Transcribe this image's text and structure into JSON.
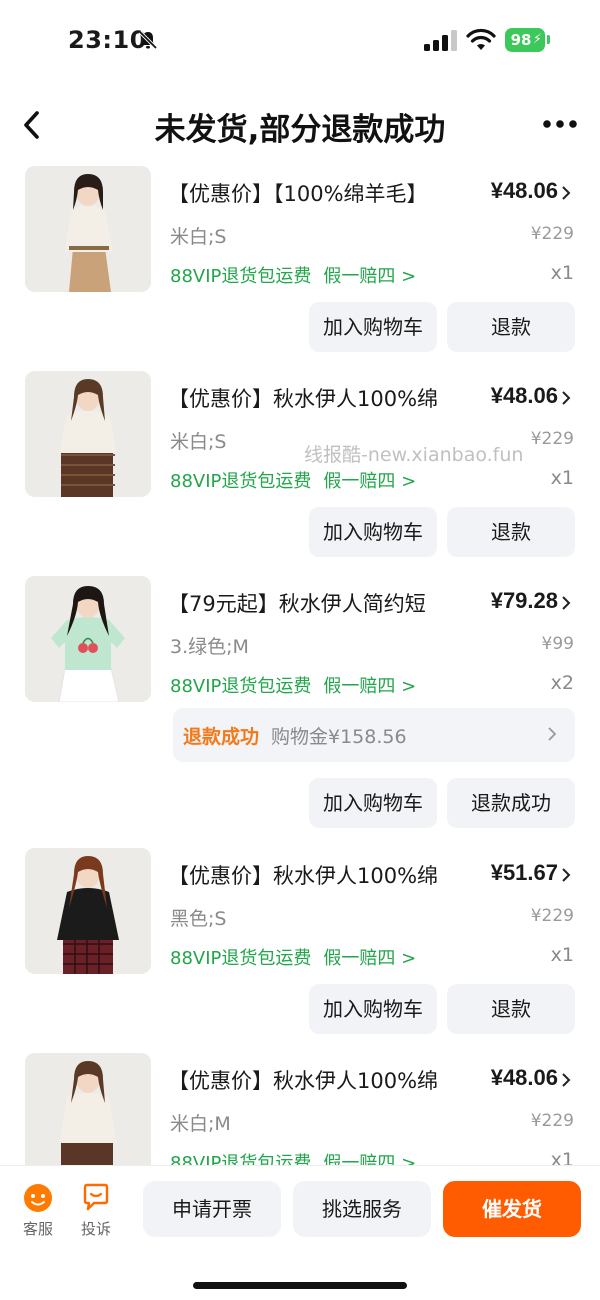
{
  "status_bar": {
    "time": "23:10",
    "battery": "98"
  },
  "header": {
    "title": "未发货,部分退款成功"
  },
  "watermark": "线报酷-new.xianbao.fun",
  "items": [
    {
      "title": "【优惠价】【100%绵羊毛】",
      "price": "¥48.06",
      "spec": "米白;S",
      "orig_price": "¥229",
      "vip": "88VIP退货包运费",
      "guarantee": "假一赔四 >",
      "qty": "x1",
      "cart_label": "加入购物车",
      "refund_label": "退款"
    },
    {
      "title": "【优惠价】秋水伊人100%绵",
      "price": "¥48.06",
      "spec": "米白;S",
      "orig_price": "¥229",
      "vip": "88VIP退货包运费",
      "guarantee": "假一赔四 >",
      "qty": "x1",
      "cart_label": "加入购物车",
      "refund_label": "退款"
    },
    {
      "title": "【79元起】秋水伊人简约短",
      "price": "¥79.28",
      "spec": "3.绿色;M",
      "orig_price": "¥99",
      "vip": "88VIP退货包运费",
      "guarantee": "假一赔四 >",
      "qty": "x2",
      "refund_status_label": "退款成功",
      "refund_status_amount": "购物金¥158.56",
      "cart_label": "加入购物车",
      "refund_label": "退款成功"
    },
    {
      "title": "【优惠价】秋水伊人100%绵",
      "price": "¥51.67",
      "spec": "黑色;S",
      "orig_price": "¥229",
      "vip": "88VIP退货包运费",
      "guarantee": "假一赔四 >",
      "qty": "x1",
      "cart_label": "加入购物车",
      "refund_label": "退款"
    },
    {
      "title": "【优惠价】秋水伊人100%绵",
      "price": "¥48.06",
      "spec": "米白;M",
      "orig_price": "¥229",
      "vip": "88VIP退货包运费",
      "guarantee": "假一赔四 >",
      "qty": "x1"
    }
  ],
  "bottom_bar": {
    "service_label": "客服",
    "complain_label": "投诉",
    "invoice_label": "申请开票",
    "select_service_label": "挑选服务",
    "urge_label": "催发货"
  },
  "colors": {
    "accent": "#ff5b00",
    "green": "#22a64a",
    "refund_orange": "#f27a1a"
  },
  "icons": [
    "bell-slash-icon",
    "signal-icon",
    "wifi-icon",
    "back-icon",
    "more-icon",
    "chevron-right-icon",
    "service-face-icon",
    "complain-chat-icon"
  ]
}
